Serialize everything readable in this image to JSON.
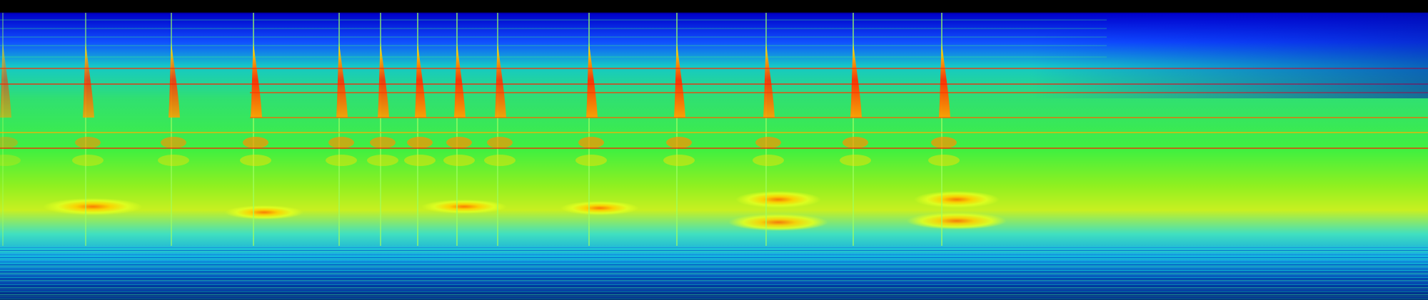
{
  "view": {
    "kind": "spectrogram",
    "colormap": [
      "#00007f",
      "#0000ff",
      "#00bfff",
      "#00ff80",
      "#bfff00",
      "#ffff00",
      "#ff8000",
      "#ff0000"
    ]
  },
  "onsets": [
    {
      "intensity": 0.55
    },
    {
      "intensity": 0.8
    },
    {
      "intensity": 0.85
    },
    {
      "intensity": 0.95
    },
    {
      "intensity": 0.9
    },
    {
      "intensity": 0.9
    },
    {
      "intensity": 0.95
    },
    {
      "intensity": 0.95
    },
    {
      "intensity": 0.9
    },
    {
      "intensity": 0.95
    },
    {
      "intensity": 0.95
    },
    {
      "intensity": 0.9
    },
    {
      "intensity": 0.95
    },
    {
      "intensity": 0.95
    }
  ],
  "sustained_tones": [
    {
      "color": "#ff3000"
    },
    {
      "color": "#ff2000"
    },
    {
      "color": "#ff3a00"
    },
    {
      "color": "#ff6000"
    },
    {
      "color": "#ffb000"
    },
    {
      "color": "#ff2000"
    }
  ]
}
